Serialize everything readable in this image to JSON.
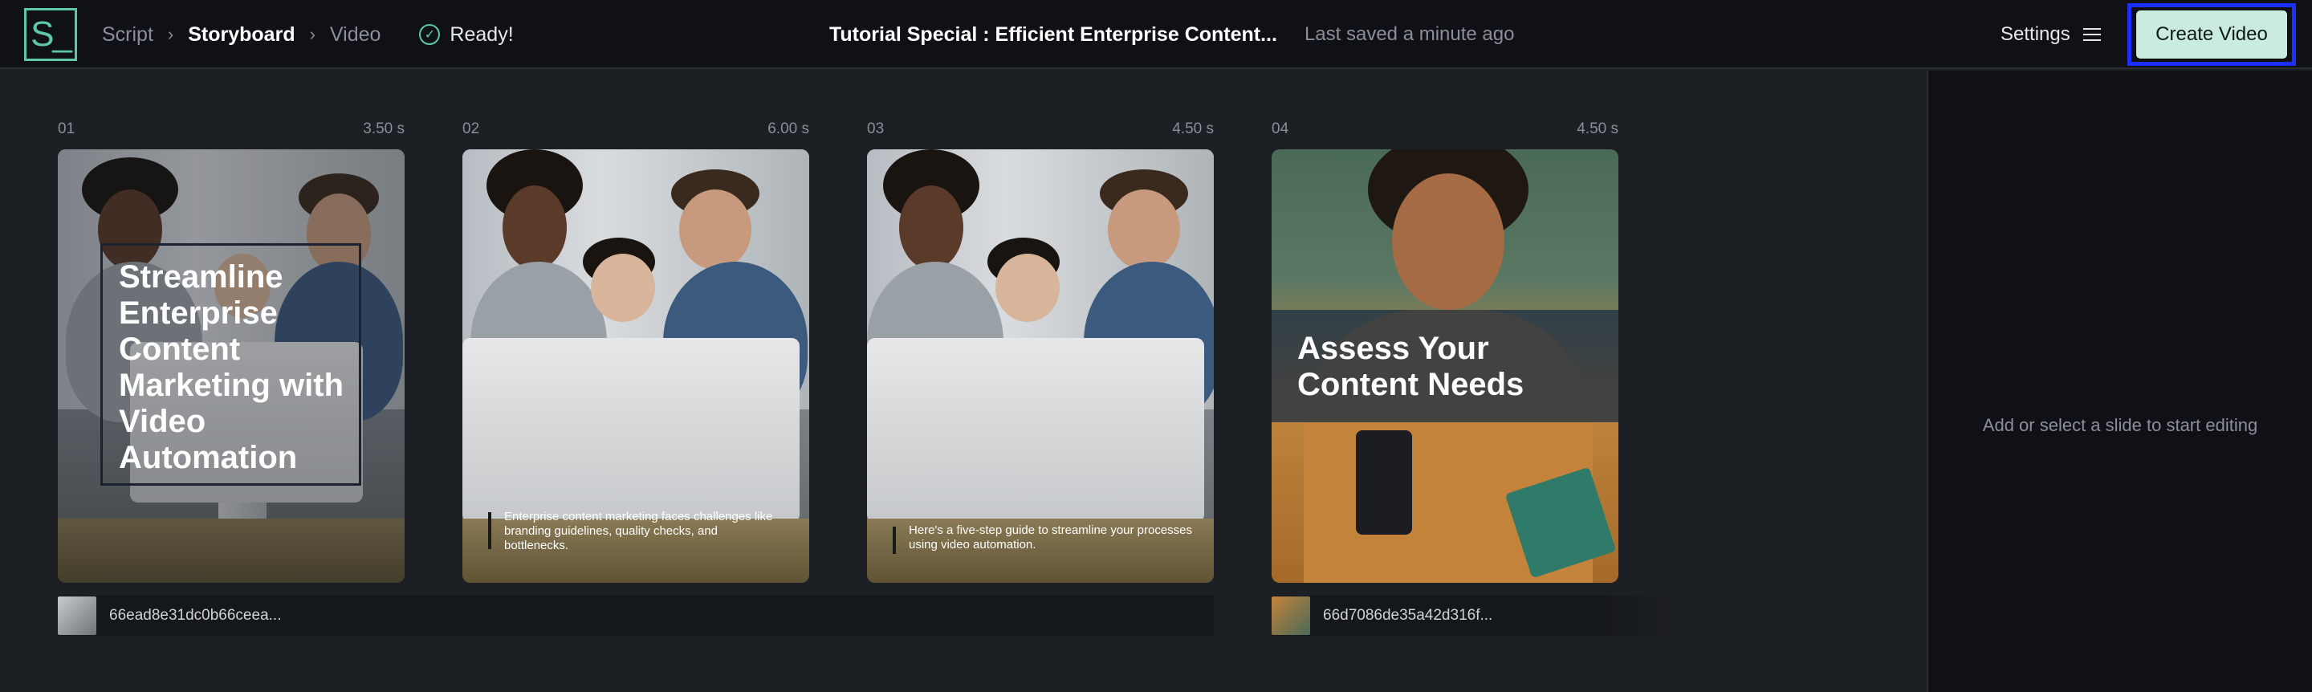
{
  "topbar": {
    "logo": "S_",
    "breadcrumbs": [
      "Script",
      "Storyboard",
      "Video"
    ],
    "status": "Ready!",
    "doc_title": "Tutorial Special : Efficient Enterprise Content...",
    "saved": "Last saved a minute ago",
    "settings_label": "Settings",
    "create_label": "Create Video"
  },
  "slides": [
    {
      "index": "01",
      "duration": "3.50 s",
      "title": "Streamline Enterprise Content Marketing with Video Automation",
      "caption": ""
    },
    {
      "index": "02",
      "duration": "6.00 s",
      "title": "",
      "caption": "Enterprise content marketing faces challenges like branding guidelines, quality checks, and bottlenecks."
    },
    {
      "index": "03",
      "duration": "4.50 s",
      "title": "",
      "caption": "Here's a five-step guide to streamline your processes using video automation."
    },
    {
      "index": "04",
      "duration": "4.50 s",
      "title": "Assess Your Content Needs",
      "caption": ""
    }
  ],
  "media": [
    {
      "label": "66ead8e31dc0b66ceea..."
    },
    {
      "label": "66d7086de35a42d316f..."
    }
  ],
  "panel": {
    "hint": "Add or select a slide to start editing"
  },
  "colors": {
    "accent": "#5fc7a9",
    "create_bg": "#c9ecdf",
    "highlight": "#1c2fff"
  }
}
